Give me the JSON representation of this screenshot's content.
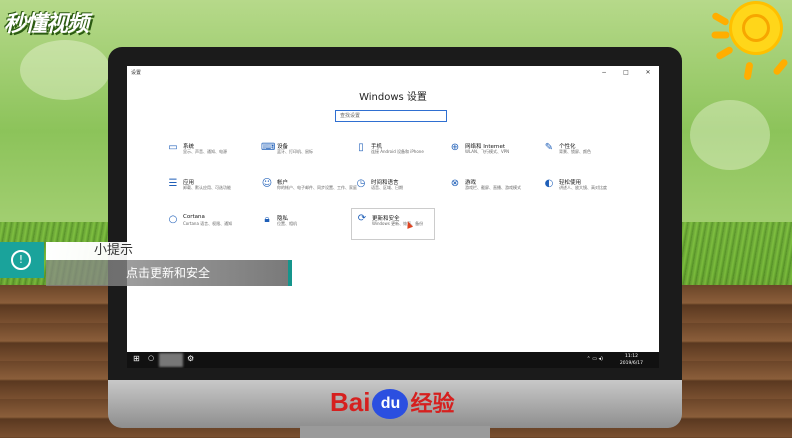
{
  "brand": {
    "logo_text": "秒懂视频",
    "footer_brand_left": "Bai",
    "footer_brand_du": "du",
    "footer_brand_right": "经验"
  },
  "window": {
    "title": "设置",
    "controls": [
      "−",
      "□",
      "✕"
    ]
  },
  "settings": {
    "heading": "Windows 设置",
    "search_placeholder": "查找设置",
    "tiles": [
      {
        "title": "系统",
        "desc": "显示、声音、通知、电源",
        "icon": "laptop-icon"
      },
      {
        "title": "设备",
        "desc": "蓝牙、打印机、鼠标",
        "icon": "devices-icon"
      },
      {
        "title": "手机",
        "desc": "连接 Android 设备和 iPhone",
        "icon": "phone-icon"
      },
      {
        "title": "网络和 Internet",
        "desc": "WLAN、飞行模式、VPN",
        "icon": "globe-icon"
      },
      {
        "title": "个性化",
        "desc": "背景、锁屏、颜色",
        "icon": "personalization-icon"
      },
      {
        "title": "应用",
        "desc": "卸载、默认应用、可选功能",
        "icon": "apps-icon"
      },
      {
        "title": "帐户",
        "desc": "你的帐户、电子邮件、同步设置、工作、家庭",
        "icon": "person-icon"
      },
      {
        "title": "时间和语言",
        "desc": "语音、区域、日期",
        "icon": "time-language-icon"
      },
      {
        "title": "游戏",
        "desc": "游戏栏、截屏、直播、游戏模式",
        "icon": "xbox-icon"
      },
      {
        "title": "轻松使用",
        "desc": "讲述人、放大镜、高对比度",
        "icon": "ease-of-access-icon"
      },
      {
        "title": "Cortana",
        "desc": "Cortana 语言、权限、通知",
        "icon": "cortana-icon"
      },
      {
        "title": "隐私",
        "desc": "位置、相机",
        "icon": "lock-icon"
      },
      {
        "title": "更新和安全",
        "desc": "Windows 更新、恢复、备份",
        "icon": "update-icon"
      }
    ]
  },
  "taskbar": {
    "time": "11:12",
    "date": "2019/6/17"
  },
  "tip": {
    "title": "小提示",
    "body": "点击更新和安全"
  },
  "colors": {
    "accent": "#1f5fb8",
    "tip_teal": "#1aa39b",
    "baidu_red": "#d6201f",
    "baidu_blue": "#2b4fe0"
  }
}
